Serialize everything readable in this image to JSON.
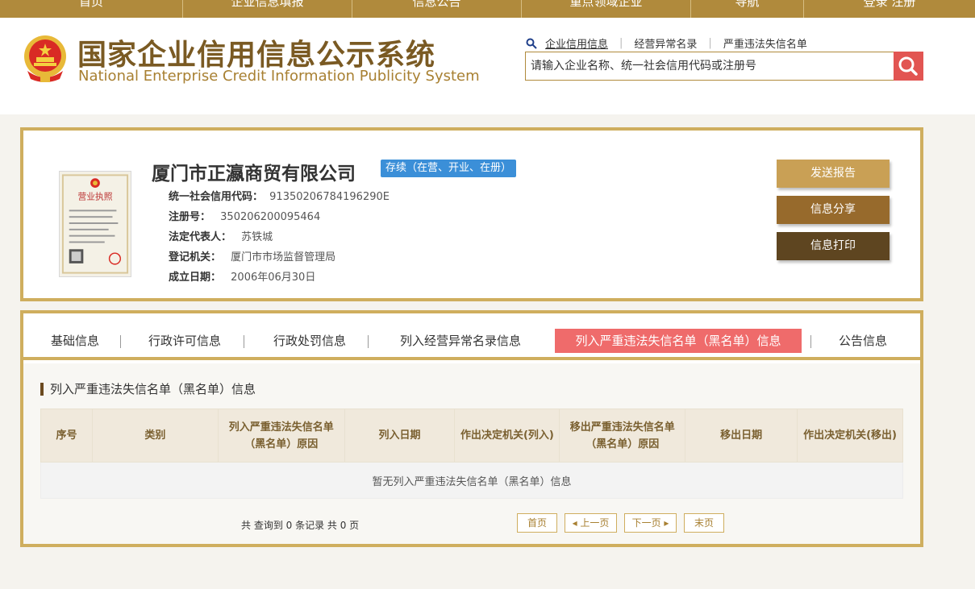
{
  "top_nav": {
    "items": [
      {
        "label": "首页"
      },
      {
        "label": "企业信息填报"
      },
      {
        "label": "信息公告"
      },
      {
        "label": "重点领域企业"
      },
      {
        "label": "导航"
      },
      {
        "label": "登录 注册"
      }
    ]
  },
  "header": {
    "title_cn": "国家企业信用信息公示系统",
    "title_en": "National Enterprise Credit Information Publicity System",
    "quick_links": [
      "企业信用信息",
      "经营异常名录",
      "严重违法失信名单"
    ],
    "search_placeholder": "请输入企业名称、统一社会信用代码或注册号"
  },
  "company": {
    "name": "厦门市正瀛商贸有限公司",
    "status": "存续（在营、开业、在册）",
    "fields": [
      {
        "label": "统一社会信用代码：",
        "value": "91350206784196290E"
      },
      {
        "label": "注册号：",
        "value": "350206200095464"
      },
      {
        "label": "法定代表人：",
        "value": "苏铁城"
      },
      {
        "label": "登记机关：",
        "value": "厦门市市场监督管理局"
      },
      {
        "label": "成立日期：",
        "value": "2006年06月30日"
      }
    ],
    "license_title": "营业执照"
  },
  "actions": [
    {
      "label": "发送报告",
      "color": "#c9a055"
    },
    {
      "label": "信息分享",
      "color": "#976a2c"
    },
    {
      "label": "信息打印",
      "color": "#5e4520"
    }
  ],
  "tabs": [
    {
      "label": "基础信息",
      "active": false
    },
    {
      "label": "行政许可信息",
      "active": false
    },
    {
      "label": "行政处罚信息",
      "active": false
    },
    {
      "label": "列入经营异常名录信息",
      "active": false
    },
    {
      "label": "列入严重违法失信名单（黑名单）信息",
      "active": true
    },
    {
      "label": "公告信息",
      "active": false
    }
  ],
  "section": {
    "title": "列入严重违法失信名单（黑名单）信息",
    "columns": [
      "序号",
      "类别",
      "列入严重违法失信名单（黑名单）原因",
      "列入日期",
      "作出决定机关(列入)",
      "移出严重违法失信名单（黑名单）原因",
      "移出日期",
      "作出决定机关(移出)"
    ],
    "empty_text": "暂无列入严重违法失信名单（黑名单）信息"
  },
  "pagination": {
    "summary": "共 查询到 0 条记录 共 0 页",
    "first": "首页",
    "prev": "上一页",
    "next": "下一页",
    "last": "末页"
  },
  "colors": {
    "gold": "#b08a3c",
    "border_gold": "#cfae5e",
    "active_tab": "#ef6b6b",
    "status_blue": "#3b8fd8",
    "search_red": "#e25552"
  }
}
